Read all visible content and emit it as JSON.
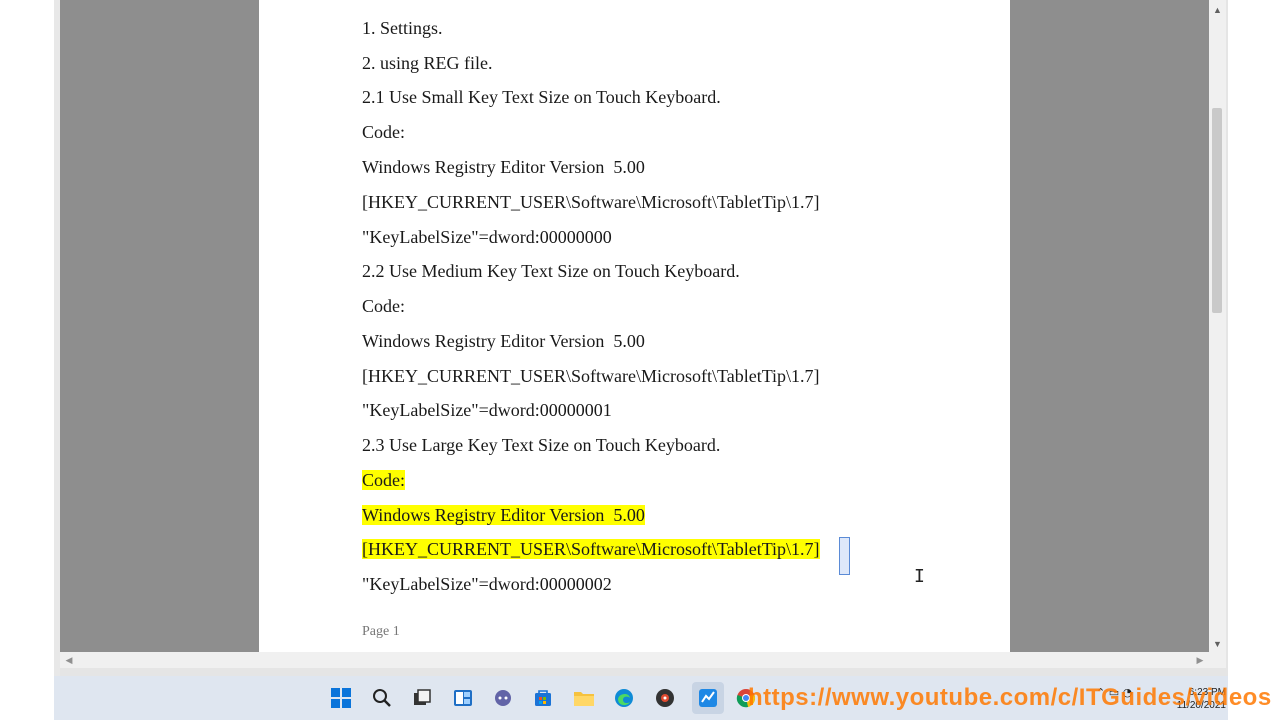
{
  "document": {
    "lines": [
      {
        "text": "1. Settings.",
        "highlight": false
      },
      {
        "text": "2. using REG file.",
        "highlight": false
      },
      {
        "text": "2.1 Use Small Key Text Size on Touch Keyboard.",
        "highlight": false
      },
      {
        "text": "Code:",
        "highlight": false
      },
      {
        "text": "Windows Registry Editor Version  5.00",
        "highlight": false
      },
      {
        "text": "[HKEY_CURRENT_USER\\Software\\Microsoft\\TabletTip\\1.7]",
        "highlight": false
      },
      {
        "text": "\"KeyLabelSize\"=dword:00000000",
        "highlight": false
      },
      {
        "text": "2.2 Use Medium Key Text Size on Touch Keyboard.",
        "highlight": false
      },
      {
        "text": "Code:",
        "highlight": false
      },
      {
        "text": "Windows Registry Editor Version  5.00",
        "highlight": false
      },
      {
        "text": "[HKEY_CURRENT_USER\\Software\\Microsoft\\TabletTip\\1.7]",
        "highlight": false
      },
      {
        "text": "\"KeyLabelSize\"=dword:00000001",
        "highlight": false
      },
      {
        "text": "2.3 Use Large Key Text Size on Touch Keyboard.",
        "highlight": false
      },
      {
        "text": "Code:",
        "highlight": true
      },
      {
        "text": "Windows Registry Editor Version  5.00",
        "highlight": true
      },
      {
        "text": "[HKEY_CURRENT_USER\\Software\\Microsoft\\TabletTip\\1.7]",
        "highlight": true
      },
      {
        "text": "\"KeyLabelSize\"=dword:00000002",
        "highlight": false
      }
    ],
    "footer": "Page 1"
  },
  "taskbar": {
    "icons": [
      "windows-start-icon",
      "search-icon",
      "task-view-icon",
      "widgets-icon",
      "chat-icon",
      "store-icon",
      "file-explorer-icon",
      "edge-icon",
      "media-icon",
      "active-app-icon",
      "chrome-icon"
    ],
    "clock_time": "6:23 PM",
    "clock_date": "11/20/2021"
  },
  "watermark": "https://www.youtube.com/c/ITGuides/videos",
  "colors": {
    "highlight": "#ffff00",
    "doc_background": "#8e8e8e",
    "page": "#ffffff",
    "taskbar": "#dfe6f0"
  }
}
